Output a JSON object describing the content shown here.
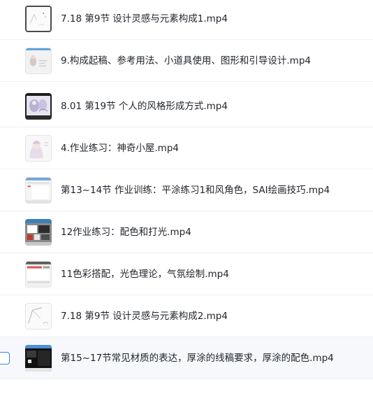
{
  "files": [
    {
      "name": "7.18 第9节 设计灵感与元素构成1.mp4",
      "thumbnail": "sketch-thumbnail"
    },
    {
      "name": "9.构成起稿、参考用法、小道具使用、图形和引导设计.mp4",
      "thumbnail": "figure-thumbnail"
    },
    {
      "name": "8.01 第19节 个人的风格形成方式.mp4",
      "thumbnail": "illustration-thumbnail"
    },
    {
      "name": "4.作业练习：神奇小屋.mp4",
      "thumbnail": "character-thumbnail"
    },
    {
      "name": "第13~14节 作业训练：平涂练习1和风角色，SAI绘画技巧.mp4",
      "thumbnail": "software-thumbnail"
    },
    {
      "name": "12作业练习：配色和打光.mp4",
      "thumbnail": "palette-thumbnail"
    },
    {
      "name": "11色彩搭配，光色理论，气氛绘制.mp4",
      "thumbnail": "color-thumbnail"
    },
    {
      "name": "7.18 第9节 设计灵感与元素构成2.mp4",
      "thumbnail": "lineart-thumbnail"
    },
    {
      "name": "第15~17节常见材质的表达，厚涂的线稿要求，厚涂的配色.mp4",
      "thumbnail": "dark-canvas-thumbnail"
    }
  ],
  "colors": {
    "accent": "#3b82f6",
    "selected_row": "#f6f8fb",
    "divider": "#eef0f4",
    "text": "#1f2329"
  }
}
